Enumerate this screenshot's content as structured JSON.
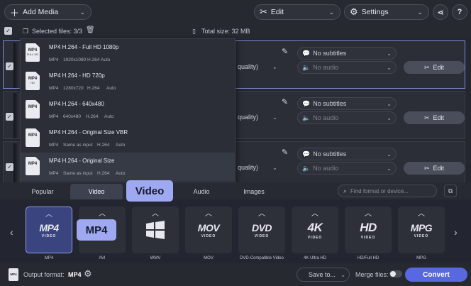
{
  "toolbar": {
    "add_media": "Add Media",
    "edit": "Edit",
    "settings": "Settings"
  },
  "subbar": {
    "selected_files": "Selected files: 3/3",
    "total_size": "Total size: 32 MB"
  },
  "files": [
    {
      "subtitles": "No subtitles",
      "audio": "No audio",
      "quality": "quality)",
      "edit": "Edit"
    },
    {
      "subtitles": "No subtitles",
      "audio": "No audio",
      "quality": "quality)",
      "edit": "Edit"
    },
    {
      "subtitles": "No subtitles",
      "audio": "No audio",
      "quality": "quality)",
      "edit": "Edit"
    }
  ],
  "presets": [
    {
      "title": "MP4 H.264 - Full HD 1080p",
      "meta": [
        "MP4",
        "1920x1080",
        "H.264",
        "Auto"
      ],
      "icon": "MP4",
      "icon_sub": "FULL HD"
    },
    {
      "title": "MP4 H.264 - HD 720p",
      "meta": [
        "MP4",
        "1280x720",
        "H.264",
        "Auto"
      ],
      "icon": "MP4",
      "icon_sub": "HD"
    },
    {
      "title": "MP4 H.264 - 640x480",
      "meta": [
        "MP4",
        "640x480",
        "H.264",
        "Auto"
      ],
      "icon": "MP4",
      "icon_sub": ""
    },
    {
      "title": "MP4 H.264 - Original Size VBR",
      "meta": [
        "MP4",
        "Same as input",
        "H.264",
        "Auto"
      ],
      "icon": "MP4",
      "icon_sub": ""
    },
    {
      "title": "MP4 H.264 - Original Size",
      "meta": [
        "MP4",
        "Same as input",
        "H.264",
        "Auto"
      ],
      "icon": "MP4",
      "icon_sub": ""
    }
  ],
  "tabs": [
    "Popular",
    "Video",
    "Audio",
    "Images"
  ],
  "search_placeholder": "Find format or device...",
  "formats": [
    {
      "logo": "MP4",
      "sub": "VIDEO",
      "label": "MP4"
    },
    {
      "logo": "",
      "sub": "",
      "label": "AVI"
    },
    {
      "logo": "",
      "sub": "",
      "label": "WMV"
    },
    {
      "logo": "MOV",
      "sub": "VIDEO",
      "label": "MOV"
    },
    {
      "logo": "DVD",
      "sub": "VIDEO",
      "label": "DVD-Compatible Video"
    },
    {
      "logo": "4K",
      "sub": "VIDEO",
      "label": "4K Ultra HD"
    },
    {
      "logo": "HD",
      "sub": "VIDEO",
      "label": "HD/Full HD"
    },
    {
      "logo": "MPG",
      "sub": "VIDEO",
      "label": "MPG"
    }
  ],
  "callouts": {
    "video": "Video",
    "mp4": "MP4"
  },
  "bottom": {
    "output_label": "Output format:",
    "output_value": "MP4",
    "save_to": "Save to...",
    "merge_files": "Merge files:",
    "convert": "Convert",
    "format_icon": "MP4"
  }
}
